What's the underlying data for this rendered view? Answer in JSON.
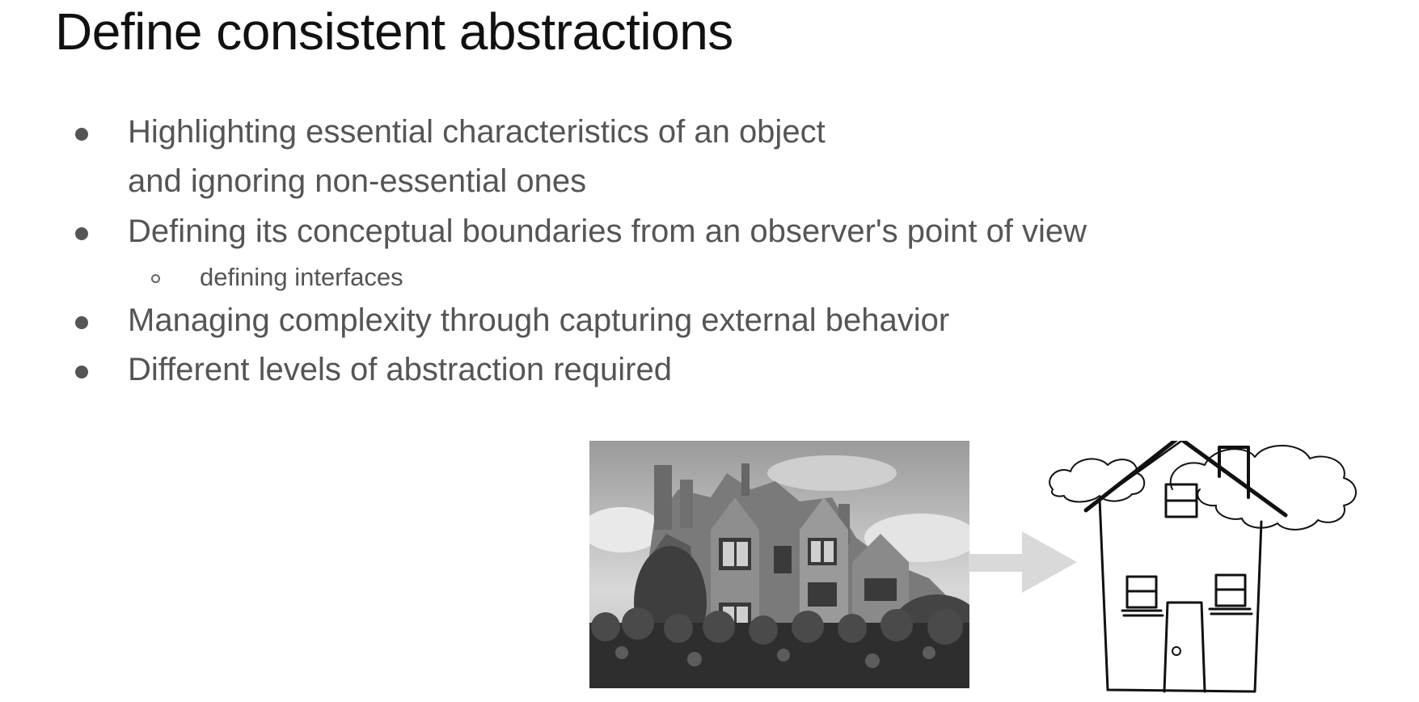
{
  "slide": {
    "title": "Define consistent abstractions",
    "bullets": [
      {
        "level": 1,
        "lines": [
          "Highlighting essential characteristics of an object",
          "and ignoring non-essential ones"
        ]
      },
      {
        "level": 1,
        "lines": [
          "Defining its conceptual boundaries from an observer's point of view"
        ]
      },
      {
        "level": 2,
        "lines": [
          "defining interfaces"
        ]
      },
      {
        "level": 1,
        "lines": [
          "Managing complexity through capturing external behavior"
        ]
      },
      {
        "level": 1,
        "lines": [
          "Different levels of abstraction required"
        ]
      }
    ]
  },
  "images": {
    "photo_icon": "grayscale-mansion-photo",
    "arrow_icon": "right-arrow-icon",
    "sketch_icon": "house-sketch-icon"
  }
}
